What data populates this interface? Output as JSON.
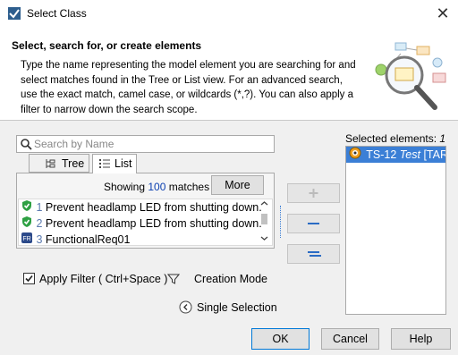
{
  "window": {
    "title": "Select Class",
    "close_label": "✕"
  },
  "header": {
    "title": "Select, search for, or create elements",
    "description": "Type the name representing the model element you are searching for and select matches found in the Tree or List view. For an advanced search, use the exact match, camel case, or wildcards (*,?). You can also apply a filter to narrow down the search scope."
  },
  "search": {
    "placeholder": "Search by Name",
    "value": ""
  },
  "tabs": [
    {
      "label": "Tree"
    },
    {
      "label": "List"
    }
  ],
  "results": {
    "showing_prefix": "Showing",
    "count": "100",
    "showing_suffix": "matches",
    "more_label": "More"
  },
  "list_items": [
    {
      "index": "1",
      "text": "Prevent headlamp LED from shutting down."
    },
    {
      "index": "2",
      "text": "Prevent headlamp LED from shutting down."
    },
    {
      "index": "3",
      "text": "FunctionalReq01"
    }
  ],
  "selected": {
    "label_prefix": "Selected elements:",
    "label_count": "1",
    "item_name": "TS-12",
    "item_type": "Test",
    "item_suffix": "[TARA"
  },
  "options": {
    "apply_filter_label": "Apply Filter ( Ctrl+Space )",
    "apply_filter_checked": true,
    "creation_mode_label": "Creation Mode",
    "single_selection_label": "Single Selection"
  },
  "buttons": {
    "ok": "OK",
    "cancel": "Cancel",
    "help": "Help"
  },
  "colors": {
    "accent": "#3b7fd6",
    "count": "#0b3fb0",
    "check_green": "#2ea043"
  }
}
